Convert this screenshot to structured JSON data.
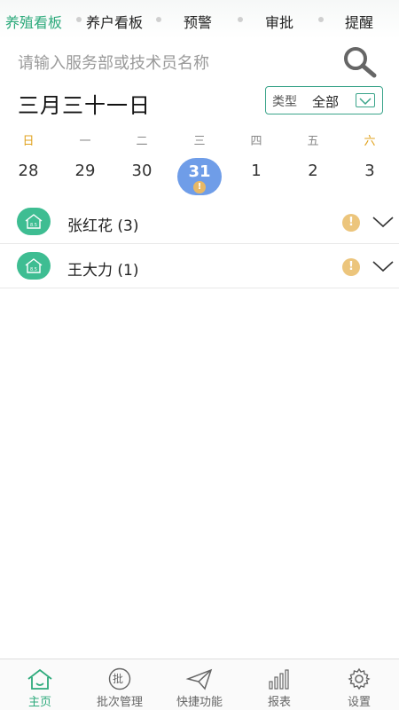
{
  "top_tabs": [
    {
      "label": "养殖看板",
      "active": true
    },
    {
      "label": "养户看板",
      "active": false
    },
    {
      "label": "预警",
      "active": false
    },
    {
      "label": "审批",
      "active": false
    },
    {
      "label": "提醒",
      "active": false
    }
  ],
  "search": {
    "placeholder": "请输入服务部或技术员名称",
    "value": "",
    "icon": "search-icon"
  },
  "date_title": "三月三十一日",
  "type_filter": {
    "label": "类型",
    "value": "全部",
    "icon": "dropdown-caret-icon"
  },
  "week": {
    "headers": [
      "日",
      "一",
      "二",
      "三",
      "四",
      "五",
      "六"
    ],
    "days": [
      "28",
      "29",
      "30",
      "31",
      "1",
      "2",
      "3"
    ],
    "selected_index": 3,
    "selected_alert": "!"
  },
  "list": [
    {
      "name": "张红花 (3)",
      "alert": "!",
      "icon": "house-icon"
    },
    {
      "name": "王大力 (1)",
      "alert": "!",
      "icon": "house-icon"
    }
  ],
  "bottom_nav": [
    {
      "label": "主页",
      "icon": "home-icon",
      "active": true
    },
    {
      "label": "批次管理",
      "icon": "batch-icon",
      "icon_text": "批",
      "active": false
    },
    {
      "label": "快捷功能",
      "icon": "paper-plane-icon",
      "active": false
    },
    {
      "label": "报表",
      "icon": "bar-chart-icon",
      "active": false
    },
    {
      "label": "设置",
      "icon": "gear-icon",
      "active": false
    }
  ],
  "colors": {
    "accent": "#2eaa7c",
    "selected_day": "#6f9de8",
    "alert": "#ecc57c",
    "weekend": "#e0a21c"
  }
}
